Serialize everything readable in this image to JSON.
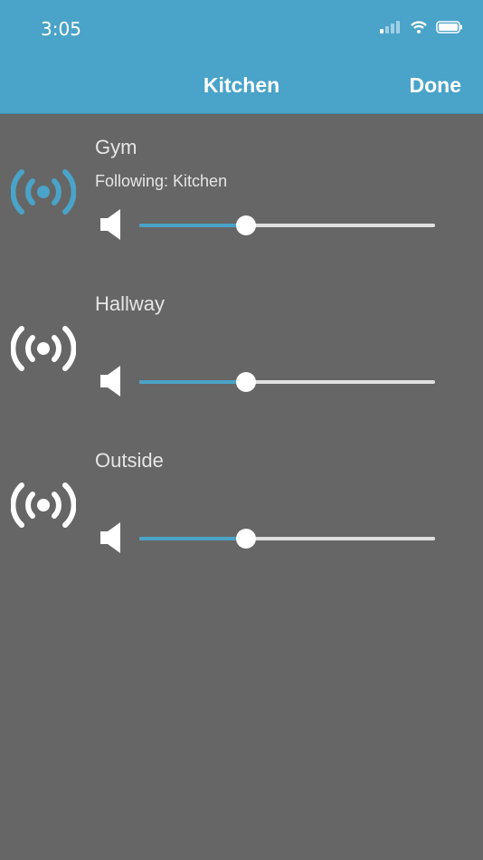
{
  "status": {
    "time": "3:05"
  },
  "nav": {
    "title": "Kitchen",
    "done_label": "Done"
  },
  "rooms": [
    {
      "name": "Gym",
      "subtitle": "Following: Kitchen",
      "volume": 0.36,
      "active": true
    },
    {
      "name": "Hallway",
      "subtitle": "",
      "volume": 0.36,
      "active": false
    },
    {
      "name": "Outside",
      "subtitle": "",
      "volume": 0.36,
      "active": false
    }
  ],
  "colors": {
    "accent": "#4aa3c8",
    "background": "#666666",
    "icon_inactive": "#ffffff",
    "track": "#e0e0e0"
  }
}
